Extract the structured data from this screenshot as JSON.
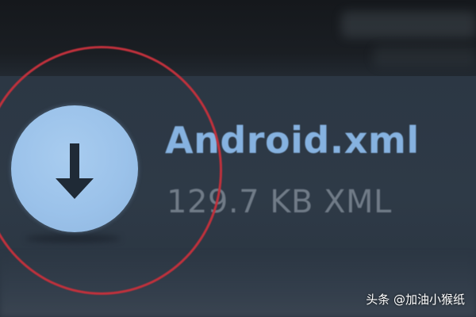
{
  "file": {
    "name": "Android.xml",
    "meta": "129.7 KB XML"
  },
  "download_icon": "arrow-down-icon",
  "colors": {
    "button_fill": "#9bc2ea",
    "file_name": "#86b2e0",
    "annotation": "#c0313c"
  },
  "watermark": "头条 @加油小猴纸"
}
